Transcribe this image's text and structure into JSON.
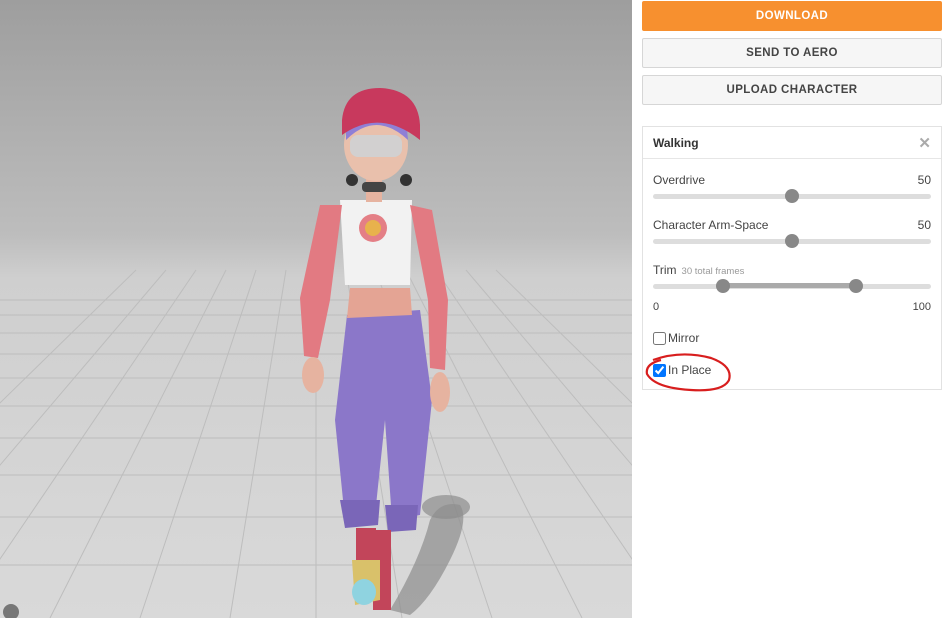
{
  "toolbar": {
    "download_label": "DOWNLOAD",
    "send_aero_label": "SEND TO AERO",
    "upload_label": "UPLOAD CHARACTER"
  },
  "animation": {
    "title": "Walking",
    "overdrive": {
      "label": "Overdrive",
      "value": "50",
      "fraction": 0.5
    },
    "arm_space": {
      "label": "Character Arm-Space",
      "value": "50",
      "fraction": 0.5
    },
    "trim": {
      "label": "Trim",
      "sub": "30 total frames",
      "min_label": "0",
      "max_label": "100",
      "start": 25,
      "end": 73
    },
    "mirror": {
      "label": "Mirror",
      "checked": false
    },
    "in_place": {
      "label": "In Place",
      "checked": true
    }
  },
  "colors": {
    "accent": "#f7902f",
    "annotation": "#d81e1e"
  }
}
